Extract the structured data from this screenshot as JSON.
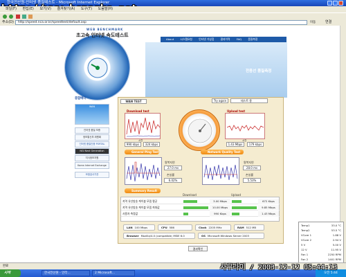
{
  "window": {
    "title": "한국전산원-인터넷 품질테스트 - Microsoft Internet Explorer",
    "watermark": "http://www.bcparks.net"
  },
  "menubar": [
    "파일(F)",
    "편집(E)",
    "보기(V)",
    "즐겨찾기(A)",
    "도구(T)",
    "도움말(H)"
  ],
  "address": {
    "label": "주소(D)",
    "url": "http://speed.nca.or.kr/speedtest/default.asp",
    "go": "이동",
    "links": "연결"
  },
  "site": {
    "logo_sub": "WEB BENCHMARK",
    "logo_main": "초고속 인터넷 속도테스트",
    "nav": [
      "About",
      "시스템요청",
      "인터넷 가상점",
      "결과이력",
      "FAQ",
      "품질측정"
    ],
    "hero_title": "전용선 품질측정",
    "dial_labels": [
      "웹 관정",
      "동영상",
      "인터넷 품질",
      "파일전송",
      "속도측정",
      "품질측정",
      "온라인게임",
      "종합"
    ]
  },
  "sidebar": {
    "title": "종합배너",
    "banners": [
      "WAN",
      "인터넷 품질 보증",
      "정보통신부 위원회",
      "인터넷 품질인증 PORTAL",
      "NGI Next Generation",
      "지식정보자원",
      "Korea Internet Exchange",
      "모범검사기관"
    ]
  },
  "panel": {
    "tab": "WAN TEST",
    "retry": "Try again",
    "select_value": "테스트 용",
    "download_title": "Download test",
    "upload_title": "Upload test",
    "dl_axis": "시간",
    "ul_axis": "시간",
    "dl_val1": "990 kbps",
    "dl_val2": "324 kbps",
    "ul_val1": "1.43 Mbps",
    "ul_val2": "179 kbps",
    "general_btn": "General Ping Test",
    "network_btn": "Network Quality Test",
    "summary_btn": "Summary Result",
    "ping_lbl": "왕복지연",
    "ping_val": "27.0 ms",
    "loss_lbl": "손실률",
    "loss_val": "6.02%",
    "ping_lbl2": "왕복지연",
    "ping_val2": "28.0 ms",
    "loss_lbl2": "손실률",
    "loss_val2": "5.53%"
  },
  "results": {
    "hdr_download": "Download",
    "hdr_upload": "Upload",
    "rows": [
      {
        "label": "지역 유선방송 케이블 모뎀 평균",
        "dl": "3.00 Mbps",
        "dl_pct": 55,
        "ul": "672 Kbps",
        "ul_pct": 40
      },
      {
        "label": "지역 유선방송 케이블 모뎀 최대값",
        "dl": "10.00 Mbps",
        "dl_pct": 100,
        "ul": "9.85 Mbps",
        "ul_pct": 100
      },
      {
        "label": "사용자 측정값",
        "dl": "990 Kbps",
        "dl_pct": 20,
        "ul": "1.43 Mbps",
        "ul_pct": 30
      }
    ]
  },
  "sysinfo": {
    "lan": "LAN",
    "lan_val": "100 Mbps",
    "cpu": "CPU",
    "cpu_val": "586",
    "clock": "Clock",
    "clock_val": "2205 MHz",
    "ram": "RAM",
    "ram_val": "512 MB",
    "browser": "Browser",
    "browser_val": "Mozilla/4.0 (compatible; MSIE 6.0",
    "os": "OS",
    "os_val": "Microsoft Windows Server 2003",
    "confirm": "결과확인"
  },
  "hwmon": [
    {
      "name": "Temp1",
      "val": "33.0 °C"
    },
    {
      "name": "Temp2",
      "val": "53.5 °C"
    },
    {
      "name": "VCore 1",
      "val": "1.88 V"
    },
    {
      "name": "VCore 2",
      "val": "2.94 V"
    },
    {
      "name": "5 V",
      "val": "5.00 V"
    },
    {
      "name": "12 V",
      "val": "11.95 V"
    },
    {
      "name": "Fan 1",
      "val": "2250 RPM"
    },
    {
      "name": "Fan 2",
      "val": "1401 RPM"
    },
    {
      "name": "AC Pwr Time",
      "val": "0 h"
    }
  ],
  "taskbar": {
    "start": "시작",
    "tasks": [
      "한국전산원 - 인터...",
      "2 Microsoft..."
    ],
    "clock": "오전 5:44"
  },
  "statusbar": {
    "text": "완료"
  },
  "overlay_stamp": "사무라이 / 2003-12-12 05:44:13"
}
